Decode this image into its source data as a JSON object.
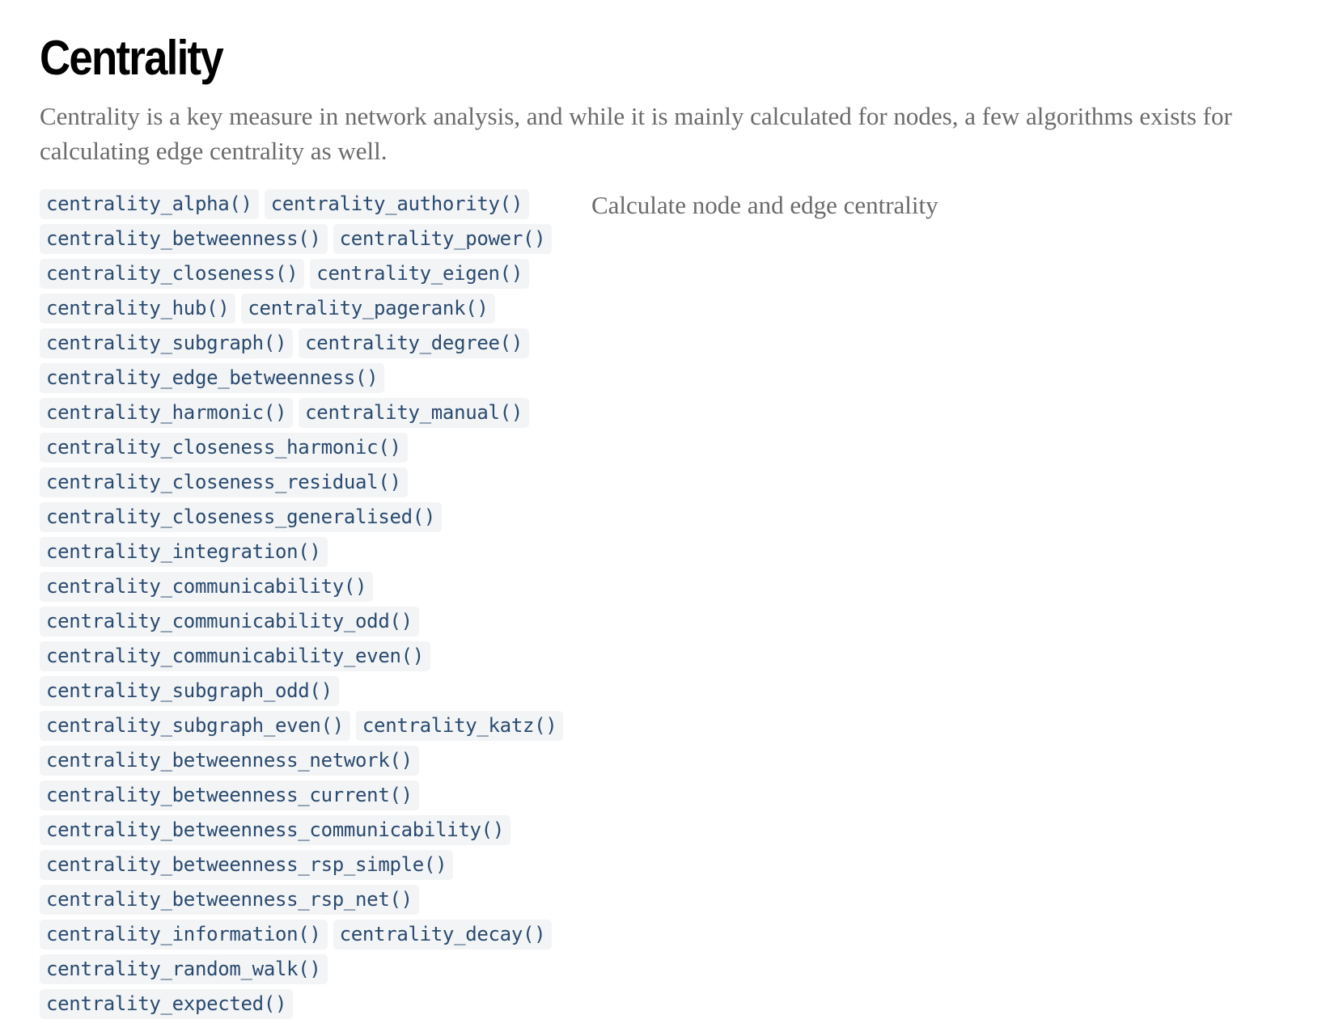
{
  "section": {
    "title": "Centrality",
    "description": "Centrality is a key measure in network analysis, and while it is mainly calculated for nodes, a few algorithms exists for calculating edge centrality as well."
  },
  "reference_block": {
    "description": "Calculate node and edge centrality",
    "rows": [
      [
        "centrality_alpha()",
        "centrality_authority()"
      ],
      [
        "centrality_betweenness()",
        "centrality_power()"
      ],
      [
        "centrality_closeness()",
        "centrality_eigen()"
      ],
      [
        "centrality_hub()",
        "centrality_pagerank()"
      ],
      [
        "centrality_subgraph()",
        "centrality_degree()"
      ],
      [
        "centrality_edge_betweenness()"
      ],
      [
        "centrality_harmonic()",
        "centrality_manual()"
      ],
      [
        "centrality_closeness_harmonic()"
      ],
      [
        "centrality_closeness_residual()"
      ],
      [
        "centrality_closeness_generalised()"
      ],
      [
        "centrality_integration()"
      ],
      [
        "centrality_communicability()"
      ],
      [
        "centrality_communicability_odd()"
      ],
      [
        "centrality_communicability_even()"
      ],
      [
        "centrality_subgraph_odd()"
      ],
      [
        "centrality_subgraph_even()",
        "centrality_katz()"
      ],
      [
        "centrality_betweenness_network()"
      ],
      [
        "centrality_betweenness_current()"
      ],
      [
        "centrality_betweenness_communicability()"
      ],
      [
        "centrality_betweenness_rsp_simple()"
      ],
      [
        "centrality_betweenness_rsp_net()"
      ],
      [
        "centrality_information()",
        "centrality_decay()"
      ],
      [
        "centrality_random_walk()"
      ],
      [
        "centrality_expected()"
      ]
    ]
  },
  "colors": {
    "title": "#000000",
    "body_text": "#6b6b6b",
    "code_text": "#294a70",
    "code_background": "#f3f4f5"
  }
}
